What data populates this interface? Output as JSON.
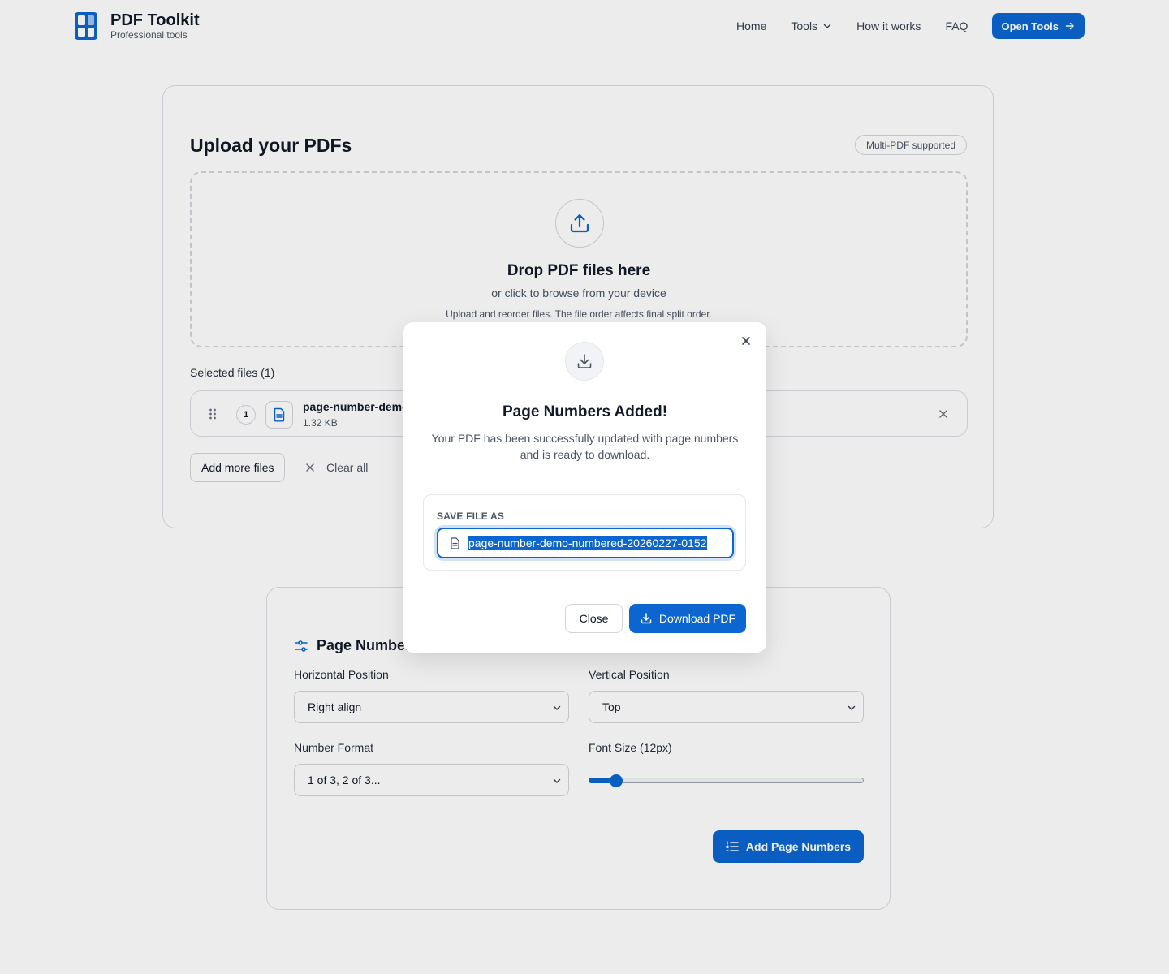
{
  "header": {
    "brand_name": "PDF Toolkit",
    "brand_tagline": "Professional tools",
    "nav": [
      {
        "label": "Home"
      },
      {
        "label": "Tools",
        "has_dropdown": true
      },
      {
        "label": "How it works"
      },
      {
        "label": "FAQ"
      }
    ],
    "cta_label": "Open Tools"
  },
  "upload": {
    "title": "Upload your PDFs",
    "badge": "Multi-PDF supported",
    "dropzone_title": "Drop PDF files here",
    "dropzone_subtitle": "or click to browse from your device",
    "dropzone_note": "Upload and reorder files. The file order affects final split order.",
    "selected_label": "Selected files (1)",
    "files": [
      {
        "index": "1",
        "name": "page-number-demo.pdf",
        "size": "1.32 KB"
      }
    ],
    "add_more_label": "Add more files",
    "clear_all_label": "Clear all"
  },
  "settings": {
    "title": "Page Numbers",
    "horizontal_label": "Horizontal Position",
    "horizontal_value": "Right align",
    "vertical_label": "Vertical Position",
    "vertical_value": "Top",
    "format_label": "Number Format",
    "format_value": "1 of 3, 2 of 3...",
    "font_size_label": "Font Size (12px)",
    "font_size_fraction": 0.08,
    "submit_label": "Add Page Numbers"
  },
  "modal": {
    "title": "Page Numbers Added!",
    "description": "Your PDF has been successfully updated with page numbers and is ready to download.",
    "save_label": "SAVE FILE AS",
    "filename": "page-number-demo-numbered-20260227-0152",
    "close_label": "Close",
    "download_label": "Download PDF"
  },
  "colors": {
    "accent": "#0c66d1",
    "border": "#d9dde3",
    "text": "#111827",
    "muted": "#4b5563"
  }
}
